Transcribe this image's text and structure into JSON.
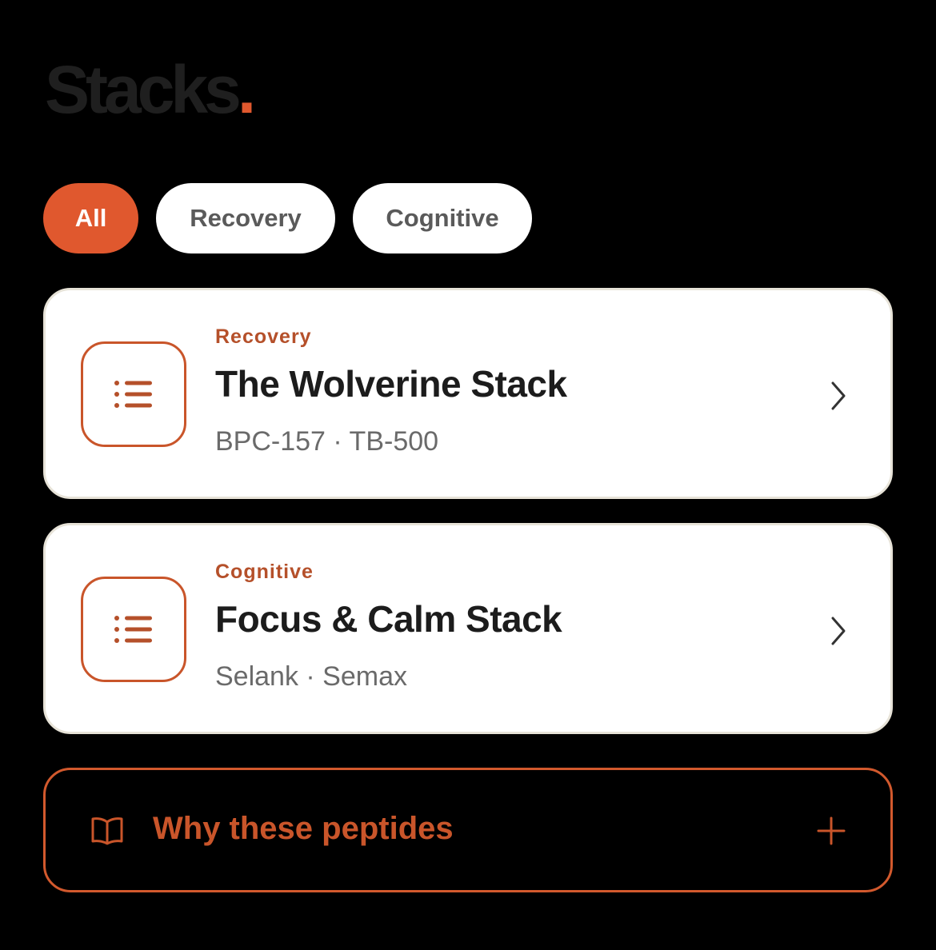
{
  "header": {
    "title": "Stacks",
    "title_dot": "."
  },
  "filters": [
    {
      "label": "All",
      "active": true
    },
    {
      "label": "Recovery",
      "active": false
    },
    {
      "label": "Cognitive",
      "active": false
    }
  ],
  "stacks": [
    {
      "category": "Recovery",
      "title": "The Wolverine Stack",
      "peptides": "BPC-157 · TB-500",
      "icon": "list-icon"
    },
    {
      "category": "Cognitive",
      "title": "Focus & Calm Stack",
      "peptides": "Selank · Semax",
      "icon": "list-icon"
    }
  ],
  "info_section": {
    "label": "Why these peptides",
    "icon": "book-icon",
    "expand_icon": "plus-icon"
  },
  "colors": {
    "accent": "#e0582e",
    "accent_text": "#b5502a",
    "background": "#000000",
    "card": "#ffffff",
    "title_dim": "#1f1f1f"
  }
}
